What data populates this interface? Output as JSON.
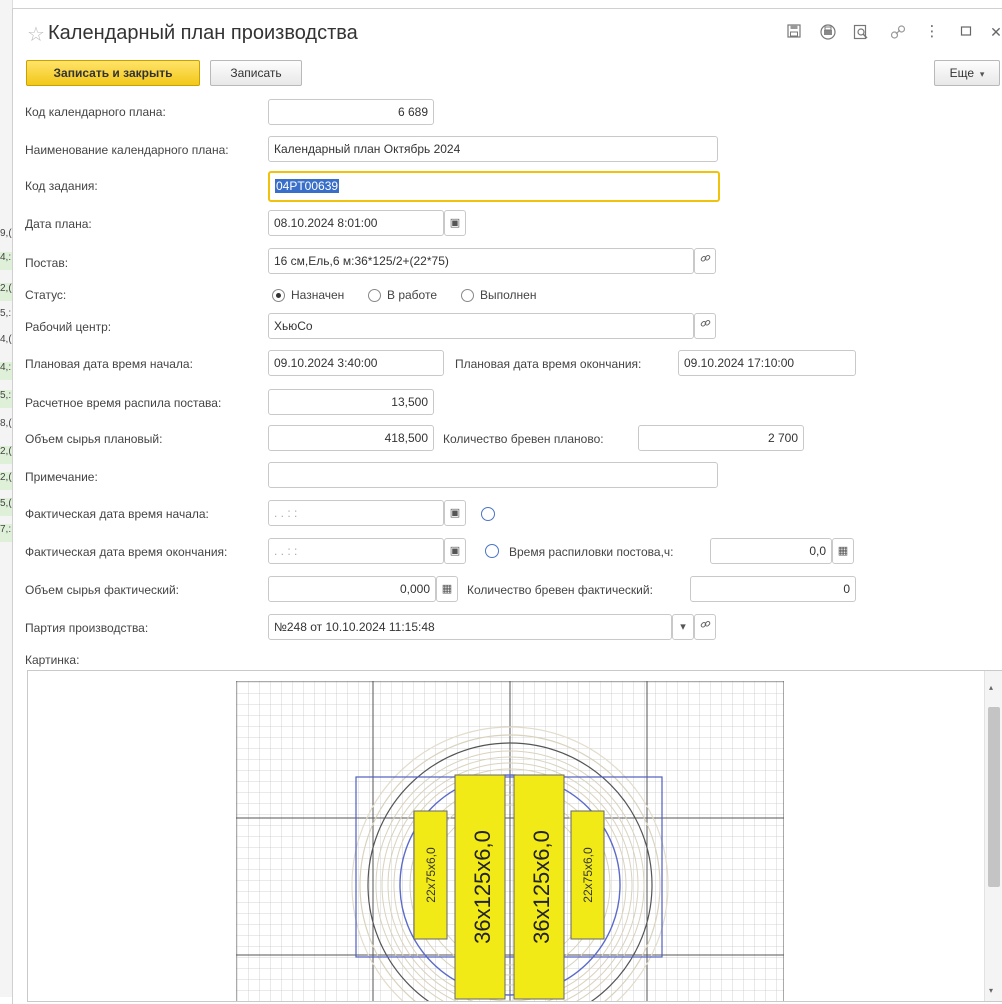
{
  "window": {
    "title": "Календарный план производства",
    "toolbar_icons": [
      "save-icon",
      "print-icon",
      "preview-icon",
      "link-icon",
      "more-icon",
      "maximize-icon",
      "close-icon"
    ]
  },
  "toolbar": {
    "save_close": "Записать и закрыть",
    "save": "Записать",
    "more": "Еще"
  },
  "form": {
    "plan_code_label": "Код календарного плана:",
    "plan_code": "6 689",
    "plan_name_label": "Наименование календарного плана:",
    "plan_name": "Календарный план Октябрь 2024",
    "task_code_label": "Код задания:",
    "task_code": "04PT00639",
    "plan_date_label": "Дата плана:",
    "plan_date": "08.10.2024  8:01:00",
    "postav_label": "Постав:",
    "postav": "16 см,Ель,6 м:36*125/2+(22*75)",
    "status_label": "Статус:",
    "status_options": [
      "Назначен",
      "В работе",
      "Выполнен"
    ],
    "status_selected": "Назначен",
    "work_center_label": "Рабочий центр:",
    "work_center": "ХьюСо",
    "plan_start_label": "Плановая дата время начала:",
    "plan_start": "09.10.2024  3:40:00",
    "plan_end_label": "Плановая дата время окончания:",
    "plan_end": "09.10.2024 17:10:00",
    "calc_time_label": "Расчетное время распила постава:",
    "calc_time": "13,500",
    "raw_volume_plan_label": "Объем сырья плановый:",
    "raw_volume_plan": "418,500",
    "logs_plan_label": "Количество бревен планово:",
    "logs_plan": "2 700",
    "note_label": "Примечание:",
    "note": "",
    "fact_start_label": "Фактическая дата время начала:",
    "fact_start_placeholder": " . .     : :",
    "fact_end_label": "Фактическая дата время окончания:",
    "fact_end_placeholder": " . .     : :",
    "saw_time_label": "Время распиловки постова,ч:",
    "saw_time": "0,0",
    "raw_volume_fact_label": "Объем сырья фактический:",
    "raw_volume_fact": "0,000",
    "logs_fact_label": "Количество бревен фактический:",
    "logs_fact": "0",
    "batch_label": "Партия производства:",
    "batch": "№248 от 10.10.2024 11:15:48",
    "picture_label": "Картинка:"
  },
  "picture": {
    "center_boards": [
      "36x125x6,0",
      "36x125x6,0"
    ],
    "side_boards": [
      "22x75x6,0",
      "22x75x6,0"
    ]
  },
  "background_window": {
    "rows": [
      {
        "text": "9,(",
        "highlight": false
      },
      {
        "text": "4,:",
        "highlight": true
      },
      {
        "text": "2,(",
        "highlight": true
      },
      {
        "text": "5,:",
        "highlight": false
      },
      {
        "text": "4,(",
        "highlight": false
      },
      {
        "text": "4,:",
        "highlight": true
      },
      {
        "text": "5,:",
        "highlight": true
      },
      {
        "text": "8,(",
        "highlight": false
      },
      {
        "text": "2,(",
        "highlight": true
      },
      {
        "text": "2,(",
        "highlight": true
      },
      {
        "text": "5,(",
        "highlight": true
      },
      {
        "text": "7,:",
        "highlight": true
      }
    ]
  }
}
